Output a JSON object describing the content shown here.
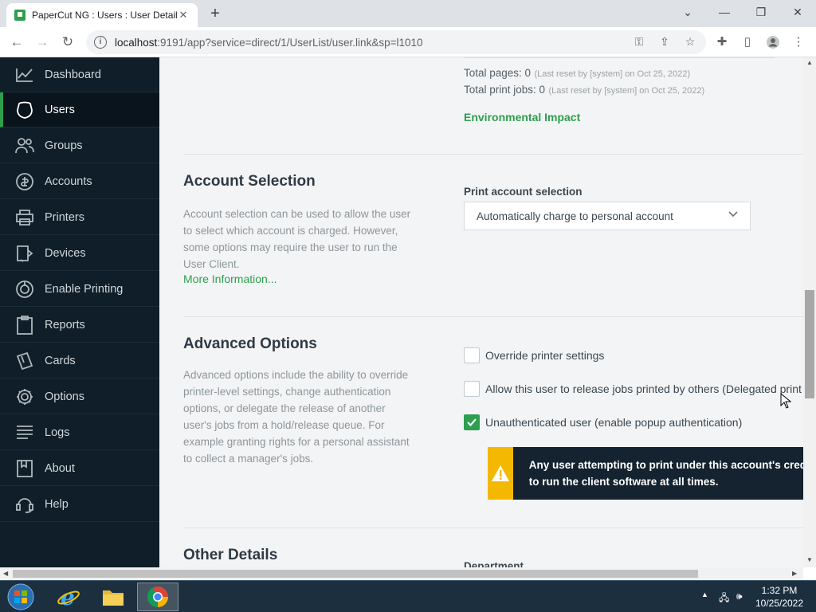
{
  "browser": {
    "tab_title": "PaperCut NG : Users : User Details",
    "tab_close": "✕",
    "new_tab": "+",
    "url_host": "localhost",
    "url_rest": ":9191/app?service=direct/1/UserList/user.link&sp=l1010",
    "window_controls": [
      "⌄",
      "—",
      "❐",
      "✕"
    ]
  },
  "sidebar": {
    "items": [
      {
        "label": "Dashboard",
        "icon": "chart-icon"
      },
      {
        "label": "Users",
        "icon": "user-icon",
        "active": true
      },
      {
        "label": "Groups",
        "icon": "groups-icon"
      },
      {
        "label": "Accounts",
        "icon": "accounts-icon"
      },
      {
        "label": "Printers",
        "icon": "printer-icon"
      },
      {
        "label": "Devices",
        "icon": "device-icon"
      },
      {
        "label": "Enable Printing",
        "icon": "enable-printing-icon"
      },
      {
        "label": "Reports",
        "icon": "reports-icon"
      },
      {
        "label": "Cards",
        "icon": "cards-icon"
      },
      {
        "label": "Options",
        "icon": "gear-icon"
      },
      {
        "label": "Logs",
        "icon": "logs-icon"
      },
      {
        "label": "About",
        "icon": "about-icon"
      },
      {
        "label": "Help",
        "icon": "help-icon"
      }
    ]
  },
  "stats": {
    "total_pages": "Total pages: 0",
    "total_pages_note": "(Last reset by [system] on Oct 25, 2022)",
    "total_jobs": "Total print jobs: 0",
    "total_jobs_note": "(Last reset by [system] on Oct 25, 2022)",
    "env_link": "Environmental Impact"
  },
  "account_selection": {
    "title": "Account Selection",
    "description": "Account selection can be used to allow the user to select which account is charged. However, some options may require the user to run the User Client.",
    "more_info": "More Information...",
    "field_label": "Print account selection",
    "selected": "Automatically charge to personal account"
  },
  "advanced_options": {
    "title": "Advanced Options",
    "description": "Advanced options include the ability to override printer-level settings, change authentication options, or delegate the release of another user's jobs from a hold/release queue. For example granting rights for a personal assistant to collect a manager's jobs.",
    "checkboxes": [
      {
        "label": "Override printer settings",
        "checked": false
      },
      {
        "label": "Allow this user to release jobs printed by others (Delegated print release)",
        "checked": false
      },
      {
        "label": "Unauthenticated user (enable popup authentication)",
        "checked": true
      }
    ],
    "warning_line1": "Any user attempting to print under this account's credentials must be able",
    "warning_line2": "to run the client software at all times."
  },
  "other_details": {
    "title": "Other Details",
    "department_label": "Department"
  },
  "taskbar": {
    "time": "1:32 PM",
    "date": "10/25/2022"
  },
  "colors": {
    "accent": "#2e9e4f",
    "sidebar_bg": "#0f1e29",
    "warning_bar": "#f5b800"
  }
}
